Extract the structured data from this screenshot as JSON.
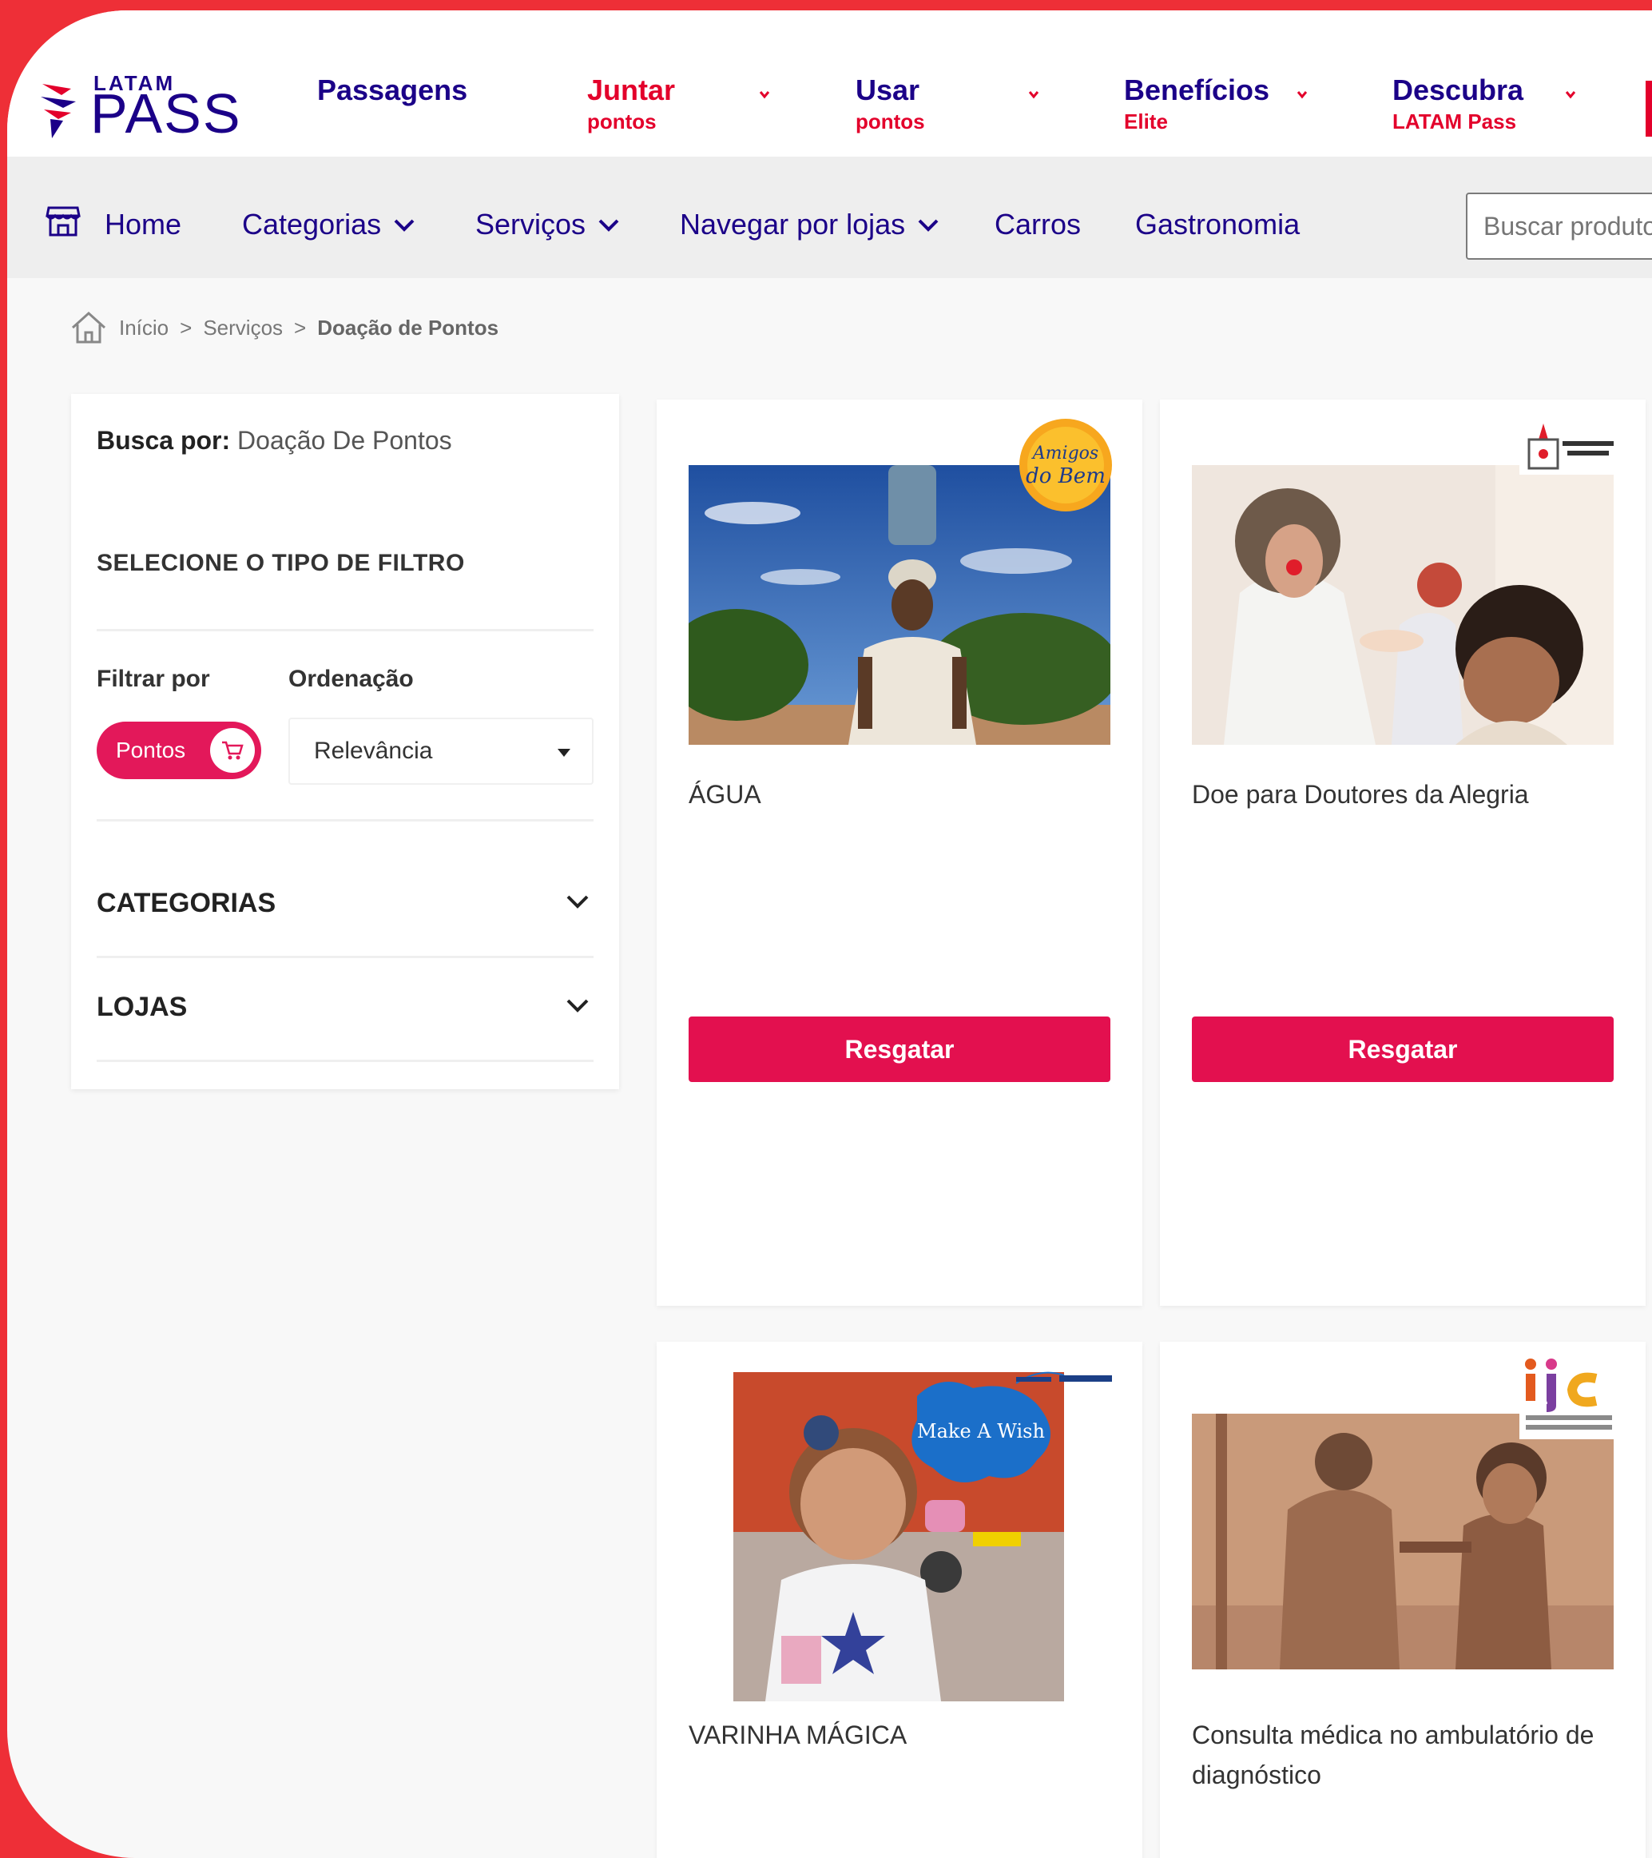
{
  "header": {
    "logo_top": "LATAM",
    "logo_main": "PASS",
    "nav": [
      {
        "label": "Passagens",
        "sub": ""
      },
      {
        "label": "Juntar",
        "sub": "pontos"
      },
      {
        "label": "Usar",
        "sub": "pontos"
      },
      {
        "label": "Benefícios",
        "sub": "Elite"
      },
      {
        "label": "Descubra",
        "sub": "LATAM Pass"
      }
    ]
  },
  "subnav": {
    "items": [
      "Home",
      "Categorias",
      "Serviços",
      "Navegar por lojas",
      "Carros",
      "Gastronomia"
    ],
    "search_placeholder": "Buscar produto"
  },
  "breadcrumb": {
    "home": "Início",
    "sep": ">",
    "level2": "Serviços",
    "current": "Doação de Pontos"
  },
  "sidebar": {
    "busca_label": "Busca por:",
    "busca_value": "Doação De Pontos",
    "select_filter": "SELECIONE O TIPO DE FILTRO",
    "filter_label": "Filtrar por",
    "sort_label": "Ordenação",
    "filter_pill": "Pontos",
    "sort_value": "Relevância",
    "categories": "CATEGORIAS",
    "stores": "LOJAS"
  },
  "products": [
    {
      "title": "ÁGUA",
      "button": "Resgatar",
      "badge": "Amigos do Bem"
    },
    {
      "title": "Doe para Doutores da Alegria",
      "button": "Resgatar",
      "badge": "Doutores da Alegria"
    },
    {
      "title": "VARINHA MÁGICA",
      "badge": "Make A Wish",
      "image_text": "Make A Wish"
    },
    {
      "title": "Consulta médica no ambulatório de diagnóstico",
      "badge": "ijc",
      "badge_sub": "Jô Clemente"
    }
  ],
  "colors": {
    "brand_navy": "#1b0088",
    "brand_red": "#e3002b",
    "button": "#e3104f",
    "frame": "#ee2f37"
  }
}
